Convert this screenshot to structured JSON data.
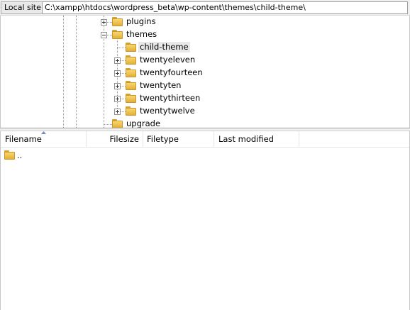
{
  "site_bar": {
    "label": "Local site:",
    "path": "C:\\xampp\\htdocs\\wordpress_beta\\wp-content\\themes\\child-theme\\"
  },
  "tree": {
    "nodes": [
      {
        "label": "plugins",
        "expander": "plus"
      },
      {
        "label": "themes",
        "expander": "minus"
      },
      {
        "label": "child-theme",
        "expander": "none",
        "selected": true
      },
      {
        "label": "twentyeleven",
        "expander": "plus"
      },
      {
        "label": "twentyfourteen",
        "expander": "plus"
      },
      {
        "label": "twentyten",
        "expander": "plus"
      },
      {
        "label": "twentythirteen",
        "expander": "plus"
      },
      {
        "label": "twentytwelve",
        "expander": "plus"
      },
      {
        "label": "upgrade",
        "expander": "none"
      }
    ]
  },
  "file_list": {
    "columns": [
      "Filename",
      "Filesize",
      "Filetype",
      "Last modified"
    ],
    "sorted_column": "Filename",
    "rows": [
      {
        "name": "..",
        "icon": "folder-icon"
      }
    ]
  },
  "icons": {
    "folder": "folder-icon",
    "expander": "tree-expander-icon",
    "sort": "sort-ascending-icon"
  },
  "colors": {
    "folder_fill": "#f2c94c",
    "selected_row": "#e8e8e8",
    "toolbar_bg": "#f0f0f0"
  }
}
